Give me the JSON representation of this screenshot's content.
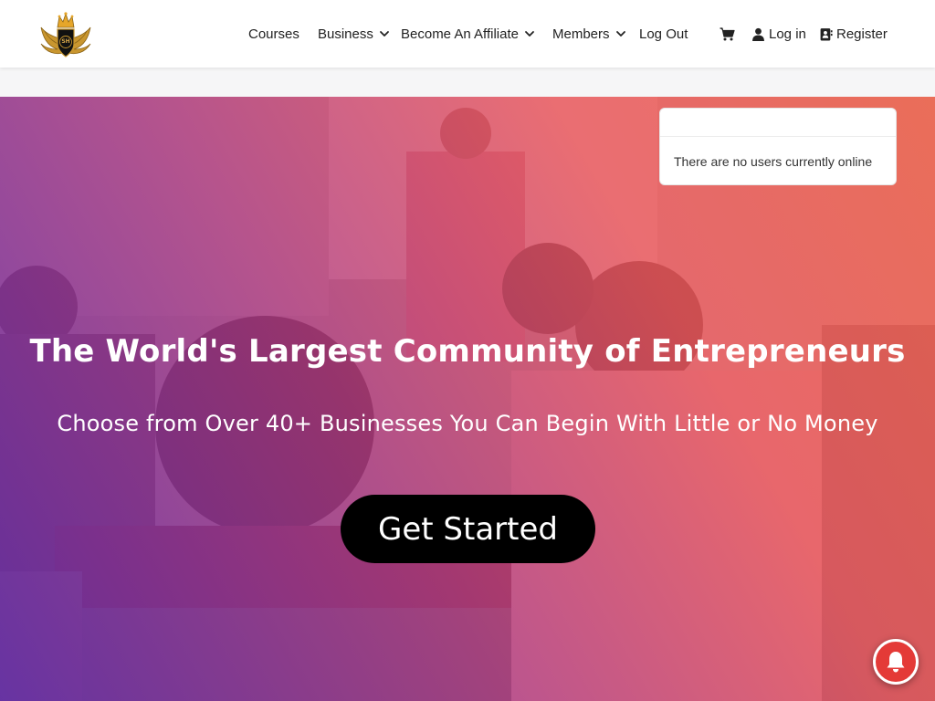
{
  "brand": {
    "logo_text": "SH"
  },
  "nav": {
    "items": [
      {
        "label": "Courses",
        "has_dropdown": false
      },
      {
        "label": "Business",
        "has_dropdown": true
      },
      {
        "label": "Become An Affiliate",
        "has_dropdown": true
      },
      {
        "label": "Members",
        "has_dropdown": true
      },
      {
        "label": "Log Out",
        "has_dropdown": false
      }
    ],
    "cart_icon": "cart-icon",
    "login_label": "Log in",
    "login_icon": "user-icon",
    "register_label": "Register",
    "register_icon": "contact-card-icon"
  },
  "widget": {
    "empty_message": "There are no users currently online"
  },
  "hero": {
    "title": "The World's Largest Community of Entrepreneurs",
    "subtitle": "Choose from Over 40+ Businesses You Can Begin With Little or No Money",
    "cta_label": "Get Started"
  },
  "notification": {
    "icon": "bell-icon"
  },
  "colors": {
    "gradient_start": "#662daa",
    "gradient_end": "#f05f46",
    "cta_bg": "#000000",
    "bell_bg": "#e43a37"
  }
}
